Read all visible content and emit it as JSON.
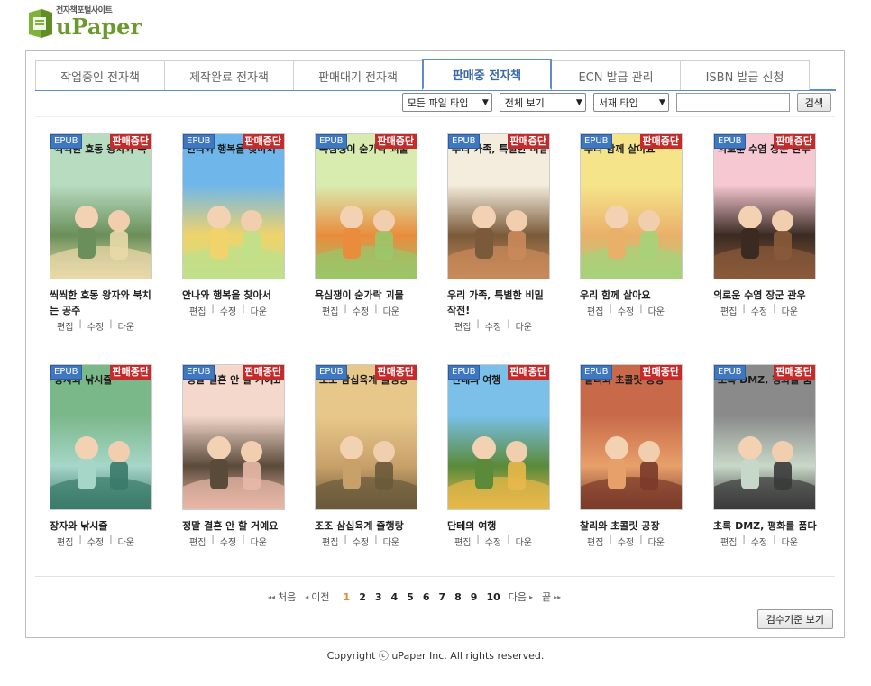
{
  "logo": {
    "subtitle": "전자책포털사이트",
    "name": "uPaper"
  },
  "tabs": [
    {
      "label": "작업중인 전자책",
      "active": false
    },
    {
      "label": "제작완료 전자책",
      "active": false
    },
    {
      "label": "판매대기 전자책",
      "active": false
    },
    {
      "label": "판매중 전자책",
      "active": true
    },
    {
      "label": "ECN 발급 관리",
      "active": false
    },
    {
      "label": "ISBN 발급 신청",
      "active": false
    }
  ],
  "filters": {
    "file_type": "모든 파일 타입",
    "view": "전체 보기",
    "shelf_type": "서재 타입",
    "search_button": "검색"
  },
  "books": [
    {
      "title": "씩씩한 호동 왕자와 북치는 공주",
      "cover_text": "씩씩한 호동 왕자와 북",
      "palette": [
        "#b8dcc0",
        "#e9d9a8",
        "#6a8f5a"
      ]
    },
    {
      "title": "안나와 행복을 찾아서",
      "cover_text": "안나와 행복을 찾아서",
      "palette": [
        "#6fb7ea",
        "#bfe08a",
        "#f0d36a"
      ]
    },
    {
      "title": "욕심쟁이 숟가락 괴물",
      "cover_text": "욕심쟁이 숟가락 괴물",
      "palette": [
        "#d9ecb0",
        "#9ac66a",
        "#e98c3c"
      ]
    },
    {
      "title": "우리 가족, 특별한 비밀 작전!",
      "cover_text": "우리 가족, 특별한 비밀",
      "palette": [
        "#f4ecdc",
        "#c98a5a",
        "#7a5a3a"
      ]
    },
    {
      "title": "우리 함께 살아요",
      "cover_text": "우리 함께 살아요",
      "palette": [
        "#f6e48a",
        "#a6d27a",
        "#e9b06a"
      ]
    },
    {
      "title": "의로운 수염 장군 관우",
      "cover_text": "의로운 수염 장군 관우",
      "palette": [
        "#f6c8d2",
        "#8a5a3a",
        "#3a2a22"
      ]
    },
    {
      "title": "장자와 낚시줄",
      "cover_text": "장자와 낚시줄",
      "palette": [
        "#7ab88a",
        "#3a7a6a",
        "#a6d6c8"
      ]
    },
    {
      "title": "정말 결혼 안 할 거예요",
      "cover_text": "정말 결혼 안 할 거예요",
      "palette": [
        "#f4d8cc",
        "#e8b8a8",
        "#5a4a3a"
      ]
    },
    {
      "title": "조조 삼십육계 줄행랑",
      "cover_text": "조조 삼십육계 줄행랑",
      "palette": [
        "#e8c88a",
        "#6a5a3a",
        "#c8a06a"
      ]
    },
    {
      "title": "단테의 여행",
      "cover_text": "단테의 여행",
      "palette": [
        "#7ac0e8",
        "#e8b84a",
        "#5a8a3a"
      ]
    },
    {
      "title": "찰리와 초콜릿 공장",
      "cover_text": "찰리와 초콜릿 공장",
      "palette": [
        "#c86a4a",
        "#7a3a2a",
        "#e8a06a"
      ]
    },
    {
      "title": "초록 DMZ, 평화를 품다",
      "cover_text": "초록 DMZ, 평화를 품다",
      "palette": [
        "#8a8a8a",
        "#3a3a3a",
        "#c8d8c8"
      ]
    }
  ],
  "book_badges": {
    "format": "EPUB",
    "status": "판매중단"
  },
  "book_actions": {
    "edit": "편집",
    "modify": "수정",
    "download": "다운",
    "sep": "|"
  },
  "pagination": {
    "first": "처음",
    "prev": "이전",
    "pages": [
      "1",
      "2",
      "3",
      "4",
      "5",
      "6",
      "7",
      "8",
      "9",
      "10"
    ],
    "current": "1",
    "next": "다음",
    "last": "끝"
  },
  "criteria_button": "검수기준 보기",
  "footer": "Copyright ⓒ uPaper Inc. All rights reserved."
}
